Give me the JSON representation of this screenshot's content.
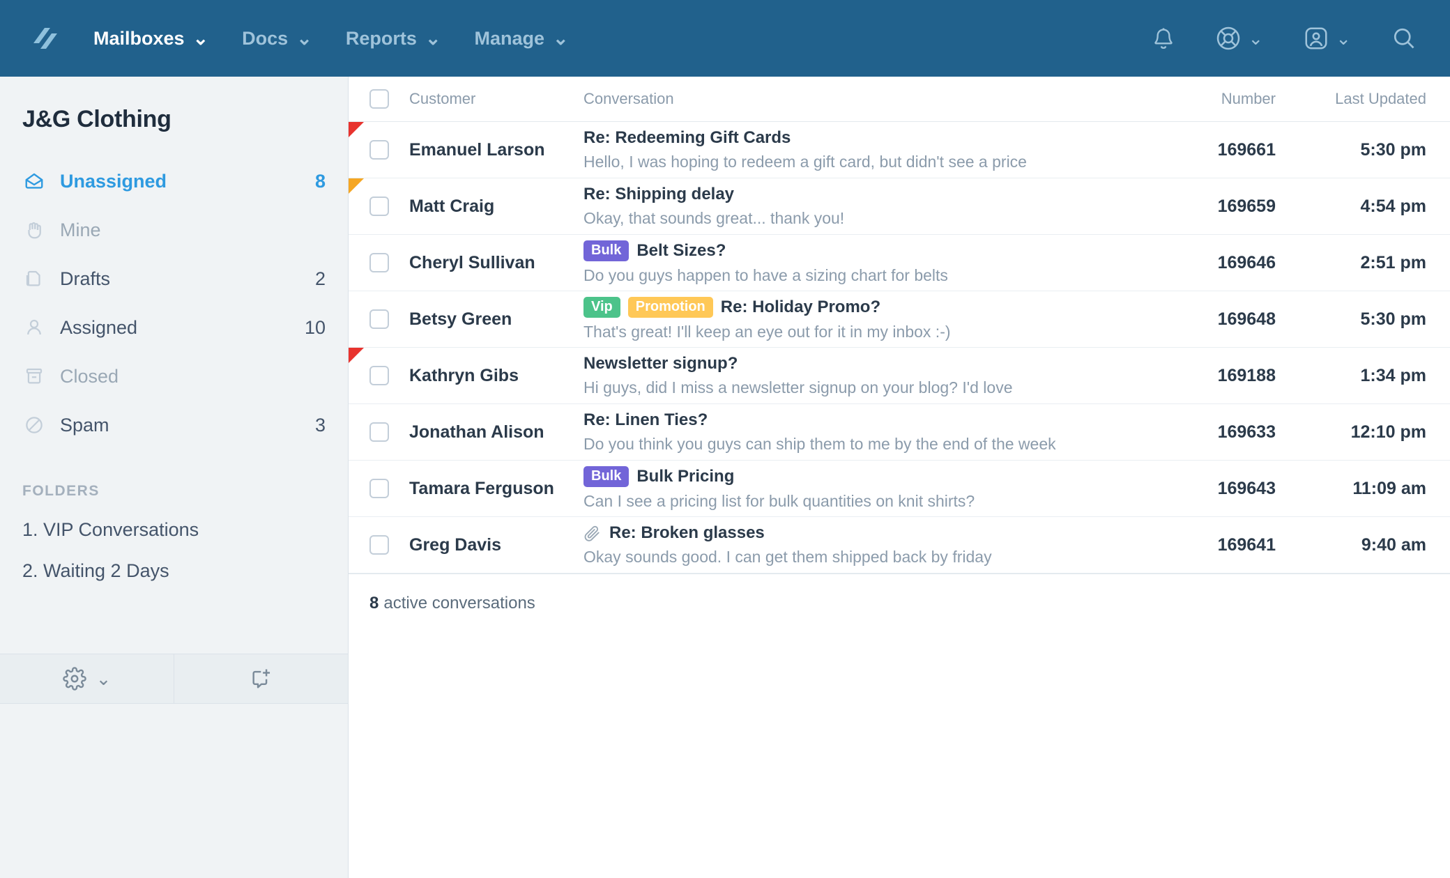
{
  "topnav": {
    "logo_icon": "helpscout-logo-icon",
    "links": [
      {
        "label": "Mailboxes",
        "active": true,
        "chevron": "⌄"
      },
      {
        "label": "Docs",
        "active": false,
        "chevron": "⌄"
      },
      {
        "label": "Reports",
        "active": false,
        "chevron": "⌄"
      },
      {
        "label": "Manage",
        "active": false,
        "chevron": "⌄"
      }
    ],
    "icons": [
      {
        "name": "bell-icon",
        "chevron": ""
      },
      {
        "name": "lifebuoy-icon",
        "chevron": "⌄"
      },
      {
        "name": "user-badge-icon",
        "chevron": "⌄"
      },
      {
        "name": "search-icon",
        "chevron": ""
      }
    ]
  },
  "sidebar": {
    "mailbox_title": "J&G Clothing",
    "items": [
      {
        "label": "Unassigned",
        "count": "8",
        "icon": "open-envelope-icon",
        "state": "selected"
      },
      {
        "label": "Mine",
        "count": "",
        "icon": "hand-icon",
        "state": "muted"
      },
      {
        "label": "Drafts",
        "count": "2",
        "icon": "drafts-icon",
        "state": "normal"
      },
      {
        "label": "Assigned",
        "count": "10",
        "icon": "person-icon",
        "state": "normal"
      },
      {
        "label": "Closed",
        "count": "",
        "icon": "archive-icon",
        "state": "muted"
      },
      {
        "label": "Spam",
        "count": "3",
        "icon": "ban-icon",
        "state": "normal"
      }
    ],
    "folders_heading": "FOLDERS",
    "folders": [
      {
        "label": "1. VIP Conversations"
      },
      {
        "label": "2. Waiting 2 Days"
      }
    ],
    "toolbar": [
      {
        "name": "settings-gear",
        "icon": "gear-icon",
        "chevron": "⌄"
      },
      {
        "name": "new-conversation",
        "icon": "new-conversation-icon",
        "chevron": ""
      }
    ]
  },
  "list": {
    "columns": {
      "customer": "Customer",
      "conversation": "Conversation",
      "number": "Number",
      "last_updated": "Last Updated"
    },
    "rows": [
      {
        "customer": "Emanuel Larson",
        "subject": "Re: Redeeming Gift Cards",
        "preview": "Hello, I was hoping to redeem a gift card, but didn't see a price",
        "number": "169661",
        "updated": "5:30 pm",
        "tags": [],
        "flag": "red",
        "attachment": false
      },
      {
        "customer": "Matt Craig",
        "subject": "Re: Shipping delay",
        "preview": "Okay, that sounds great... thank you!",
        "number": "169659",
        "updated": "4:54 pm",
        "tags": [],
        "flag": "orange",
        "attachment": false
      },
      {
        "customer": "Cheryl Sullivan",
        "subject": "Belt Sizes?",
        "preview": "Do you guys happen to have a sizing chart for belts",
        "number": "169646",
        "updated": "2:51 pm",
        "tags": [
          {
            "label": "Bulk",
            "color": "bulk"
          }
        ],
        "flag": "none",
        "attachment": false
      },
      {
        "customer": "Betsy Green",
        "subject": "Re: Holiday Promo?",
        "preview": "That's great! I'll keep an eye out for it in my inbox :-)",
        "number": "169648",
        "updated": "5:30 pm",
        "tags": [
          {
            "label": "Vip",
            "color": "vip"
          },
          {
            "label": "Promotion",
            "color": "promotion"
          }
        ],
        "flag": "none",
        "attachment": false
      },
      {
        "customer": "Kathryn Gibs",
        "subject": "Newsletter signup?",
        "preview": "Hi guys, did I miss a newsletter signup on your blog? I'd love",
        "number": "169188",
        "updated": "1:34 pm",
        "tags": [],
        "flag": "red",
        "attachment": false
      },
      {
        "customer": "Jonathan Alison",
        "subject": "Re: Linen Ties?",
        "preview": "Do you think you guys can ship them to me by the end of the week",
        "number": "169633",
        "updated": "12:10 pm",
        "tags": [],
        "flag": "none",
        "attachment": false
      },
      {
        "customer": "Tamara Ferguson",
        "subject": "Bulk Pricing",
        "preview": "Can I see a pricing list for bulk quantities on knit shirts?",
        "number": "169643",
        "updated": "11:09 am",
        "tags": [
          {
            "label": "Bulk",
            "color": "bulk"
          }
        ],
        "flag": "none",
        "attachment": false
      },
      {
        "customer": "Greg Davis",
        "subject": "Re: Broken glasses",
        "preview": "Okay sounds good. I can get them shipped back by friday",
        "number": "169641",
        "updated": "9:40 am",
        "tags": [],
        "flag": "none",
        "attachment": true
      }
    ],
    "footer_count": "8",
    "footer_text": "active conversations"
  },
  "colors": {
    "nav_bg": "#21618c",
    "accent_blue": "#2e9ae0",
    "flag_red": "#e8332e",
    "flag_orange": "#f5a623",
    "tag_bulk": "#7265d8",
    "tag_vip": "#4cc38a",
    "tag_promotion": "#ffc857"
  }
}
